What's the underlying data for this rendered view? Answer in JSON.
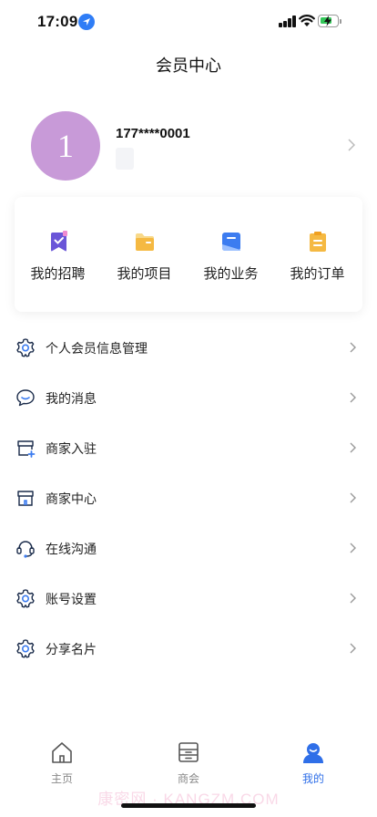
{
  "status_bar": {
    "time": "17:09"
  },
  "header": {
    "title": "会员中心"
  },
  "profile": {
    "avatar_text": "1",
    "phone": "177****0001"
  },
  "quick_actions": [
    {
      "label": "我的招聘",
      "icon": "bookmark-check-icon"
    },
    {
      "label": "我的项目",
      "icon": "folder-icon"
    },
    {
      "label": "我的业务",
      "icon": "business-icon"
    },
    {
      "label": "我的订单",
      "icon": "clipboard-icon"
    }
  ],
  "menu": [
    {
      "label": "个人会员信息管理",
      "icon": "gear-icon"
    },
    {
      "label": "我的消息",
      "icon": "message-icon"
    },
    {
      "label": "商家入驻",
      "icon": "store-add-icon"
    },
    {
      "label": "商家中心",
      "icon": "store-icon"
    },
    {
      "label": "在线沟通",
      "icon": "headset-icon"
    },
    {
      "label": "账号设置",
      "icon": "gear-icon"
    },
    {
      "label": "分享名片",
      "icon": "gear-icon"
    }
  ],
  "tabs": [
    {
      "label": "主页",
      "icon": "home-icon"
    },
    {
      "label": "商会",
      "icon": "chamber-icon"
    },
    {
      "label": "我的",
      "icon": "user-icon"
    }
  ],
  "watermark": "康密网 · KANGZM.COM",
  "colors": {
    "accent": "#2f6fe8",
    "avatar": "#c89ad8",
    "orange": "#f5b942",
    "purple": "#6a55d8"
  }
}
